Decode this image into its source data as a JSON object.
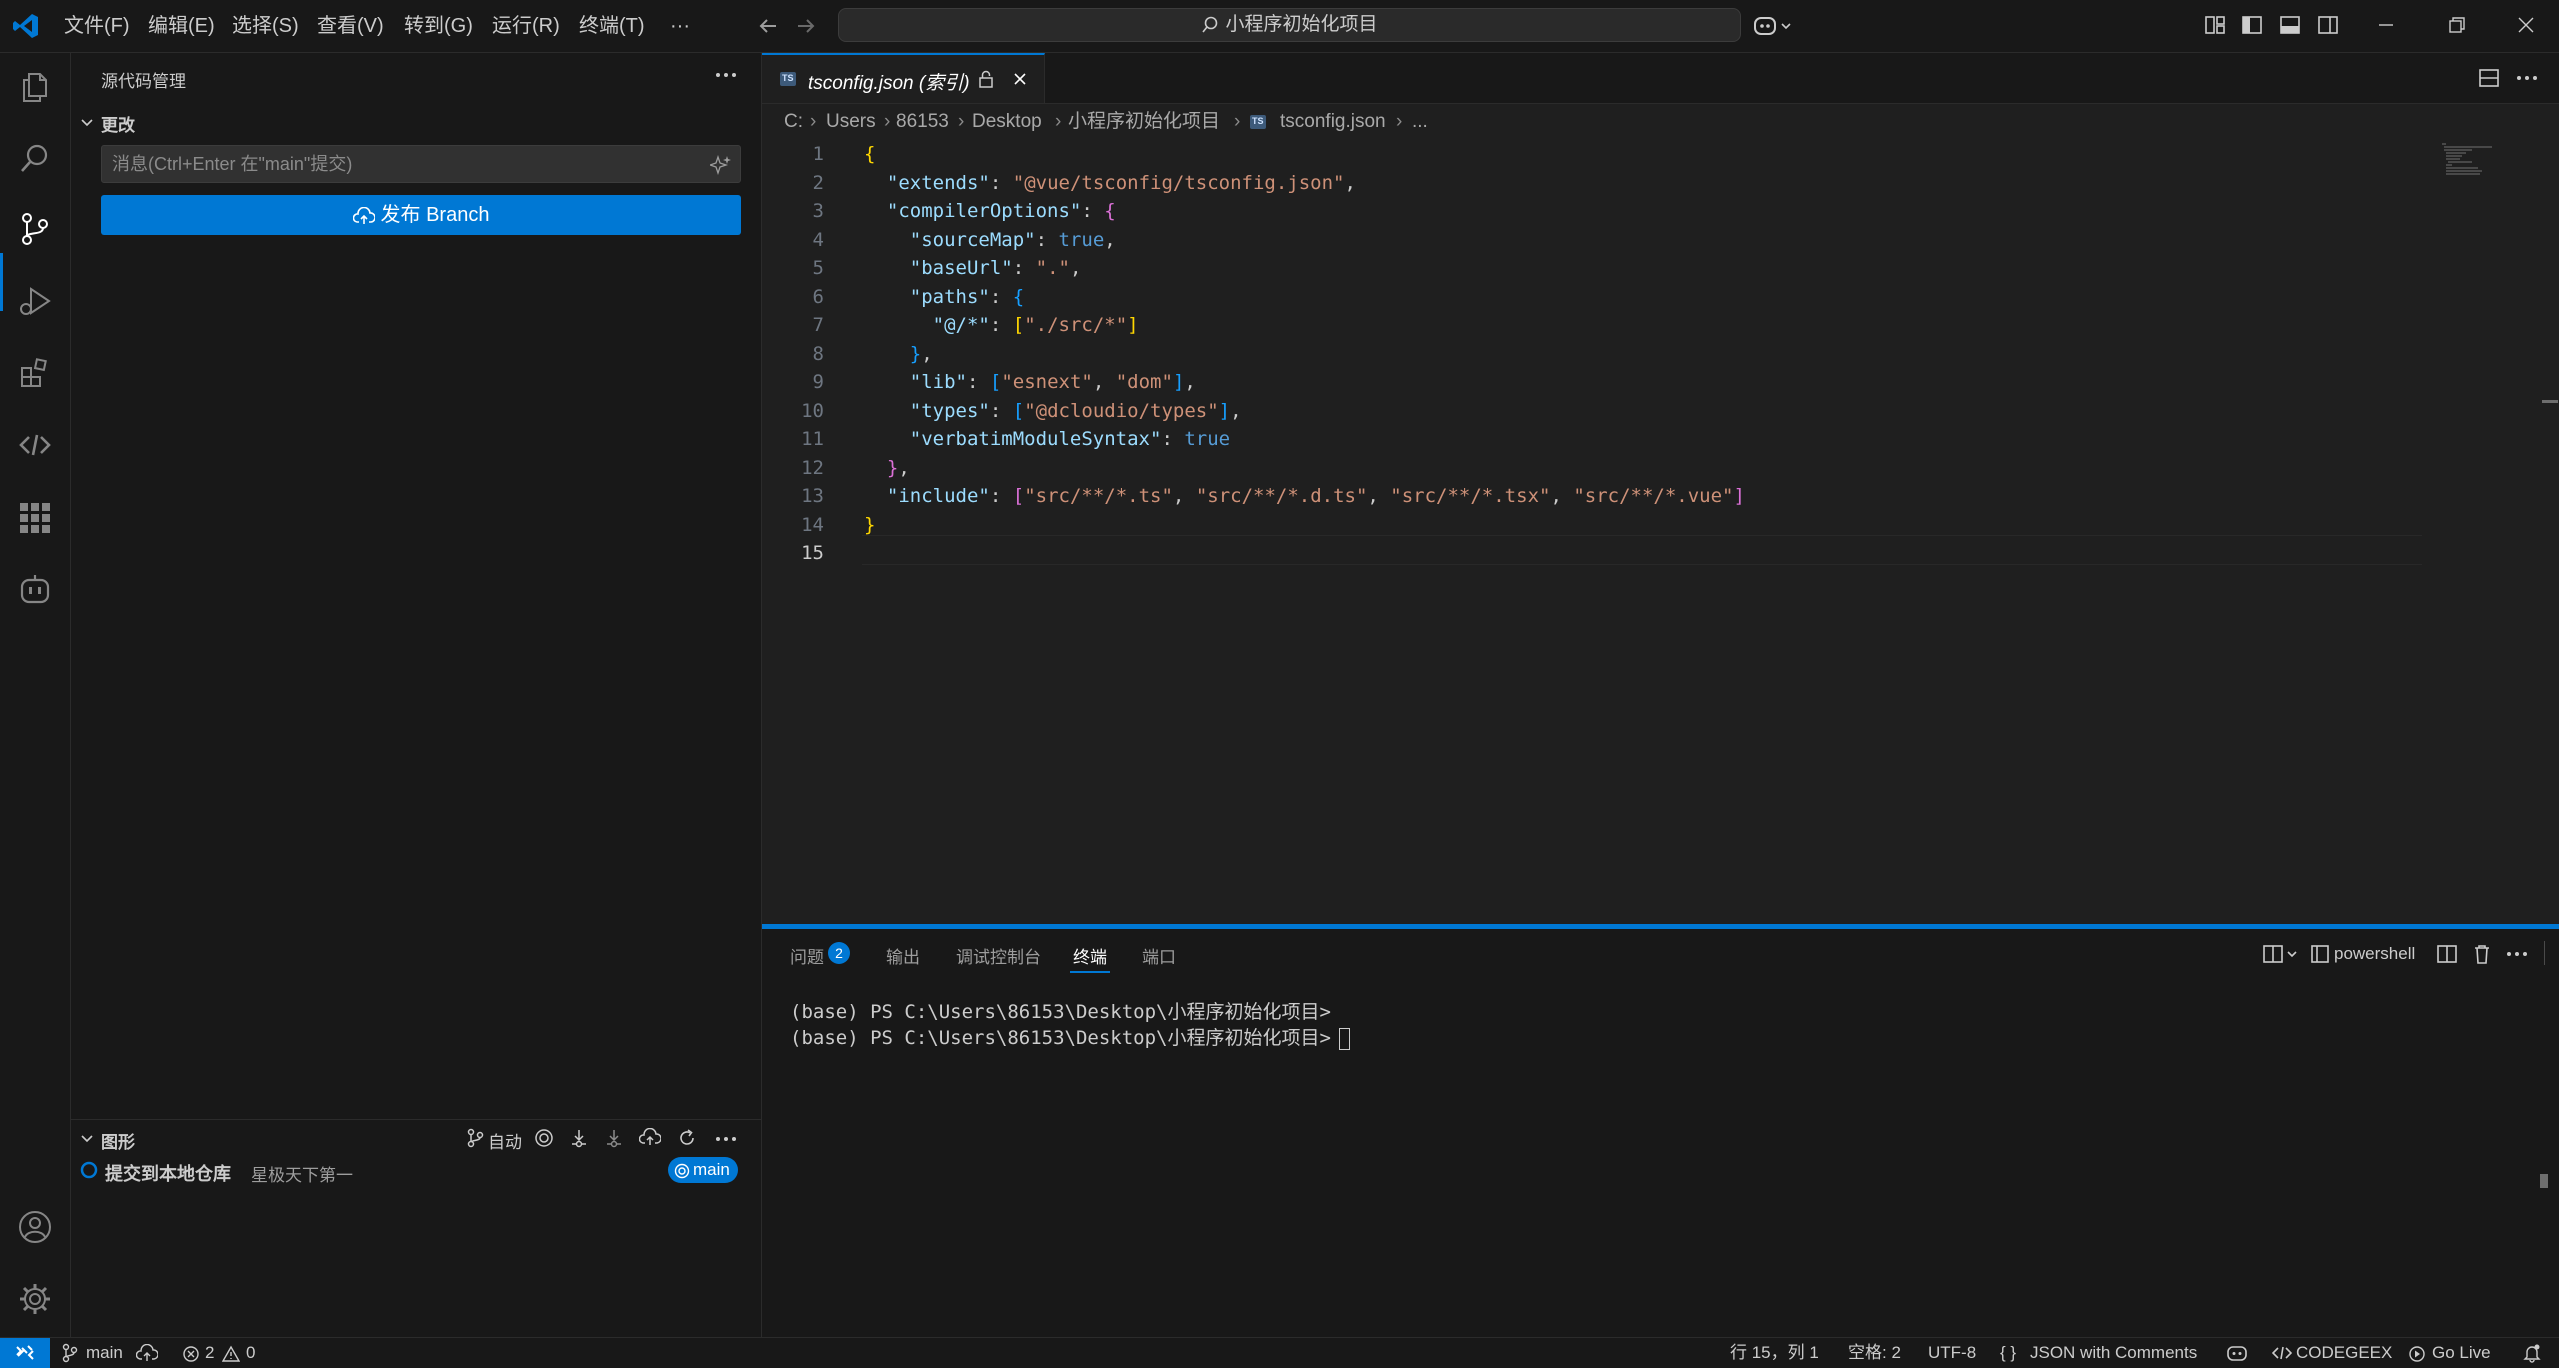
{
  "menu": [
    "文件(F)",
    "编辑(E)",
    "选择(S)",
    "查看(V)",
    "转到(G)",
    "运行(R)",
    "终端(T)",
    "···"
  ],
  "search": {
    "text": "小程序初始化项目"
  },
  "sidebar": {
    "title": "源代码管理",
    "changes_header": "更改",
    "commit_placeholder": "消息(Ctrl+Enter 在\"main\"提交)",
    "publish_label": "发布 Branch",
    "graph_header": "图形",
    "graph_auto": "自动",
    "graph_commit_title": "提交到本地仓库",
    "graph_commit_author": "星极天下第一",
    "graph_branch": "main"
  },
  "editor": {
    "tab_label": "tsconfig.json (索引)",
    "breadcrumb": [
      "C:",
      "Users",
      "86153",
      "Desktop",
      "小程序初始化项目",
      "tsconfig.json",
      "..."
    ]
  },
  "code_lines": [
    "{",
    "  \"extends\": \"@vue/tsconfig/tsconfig.json\",",
    "  \"compilerOptions\": {",
    "    \"sourceMap\": true,",
    "    \"baseUrl\": \".\",",
    "    \"paths\": {",
    "      \"@/*\": [\"./src/*\"]",
    "    },",
    "    \"lib\": [\"esnext\", \"dom\"],",
    "    \"types\": [\"@dcloudio/types\"],",
    "    \"verbatimModuleSyntax\": true",
    "  },",
    "  \"include\": [\"src/**/*.ts\", \"src/**/*.d.ts\", \"src/**/*.tsx\", \"src/**/*.vue\"]",
    "}",
    ""
  ],
  "line_numbers": [
    "1",
    "2",
    "3",
    "4",
    "5",
    "6",
    "7",
    "8",
    "9",
    "10",
    "11",
    "12",
    "13",
    "14",
    "15"
  ],
  "panel": {
    "tabs": {
      "problems": "问题",
      "problems_count": "2",
      "output": "输出",
      "debug": "调试控制台",
      "terminal": "终端",
      "ports": "端口"
    },
    "shell": "powershell",
    "terminal_lines": [
      "(base) PS C:\\Users\\86153\\Desktop\\小程序初始化项目>",
      "(base) PS C:\\Users\\86153\\Desktop\\小程序初始化项目>"
    ]
  },
  "status": {
    "branch": "main",
    "errors": "2",
    "warnings": "0",
    "position": "行 15，列 1",
    "spaces": "空格: 2",
    "encoding": "UTF-8",
    "language": "JSON with Comments",
    "codegeex": "CODEGEEX",
    "golive": "Go Live"
  },
  "colors": {
    "accent": "#0078d4",
    "background": "#1f1f1f",
    "sidebar": "#181818"
  }
}
